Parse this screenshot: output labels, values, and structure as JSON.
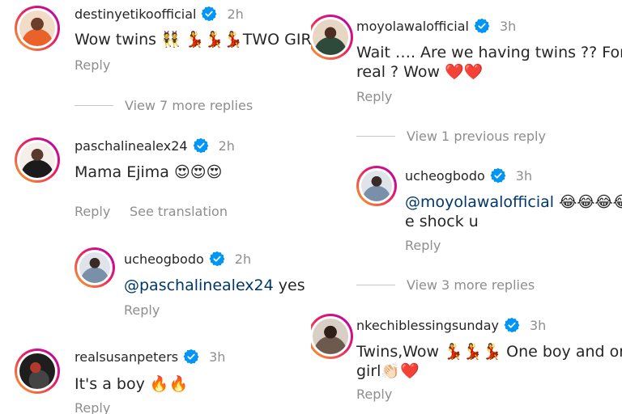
{
  "left": {
    "c1": {
      "username": "destinyetikoofficial",
      "time": "2h",
      "text": "Wow twins 👯 💃💃💃TWO GIR",
      "reply": "Reply"
    },
    "c1_view_more": "View 7 more replies",
    "c2": {
      "username": "paschalinealex24",
      "time": "2h",
      "text": "Mama Ejima 😍😍😍",
      "reply": "Reply",
      "translate": "See translation"
    },
    "c2_reply": {
      "username": "ucheogbodo",
      "time": "2h",
      "mention": "@paschalinealex24",
      "text": " yes",
      "reply": "Reply"
    },
    "c3": {
      "username": "realsusanpeters",
      "time": "3h",
      "text": "It's a boy 🔥🔥",
      "reply": "Reply"
    }
  },
  "right": {
    "c1": {
      "username": "moyolawalofficial",
      "time": "3h",
      "text_line1": "Wait …. Are we having twins ?? For",
      "text_line2": "real ? Wow ❤️❤️",
      "reply": "Reply"
    },
    "c1_previous": "View 1 previous reply",
    "c1_reply": {
      "username": "ucheogbodo",
      "time": "3h",
      "mention": "@moyolawalofficial",
      "emojis": " 😂😂😂😂",
      "text_line2": "e shock u",
      "reply": "Reply"
    },
    "c1_view_more": "View 3 more replies",
    "c2": {
      "username": "nkechiblessingsunday",
      "time": "3h",
      "text_line1": "Twins,Wow 💃💃💃 One boy and one",
      "text_line2": "girl👏🏻❤️",
      "reply": "Reply"
    }
  },
  "colors": {
    "text": "#262626",
    "muted": "#8e8e8e",
    "mention": "#00376b",
    "verified": "#0095f6"
  },
  "icons": {
    "verified": "verified-badge-icon"
  }
}
